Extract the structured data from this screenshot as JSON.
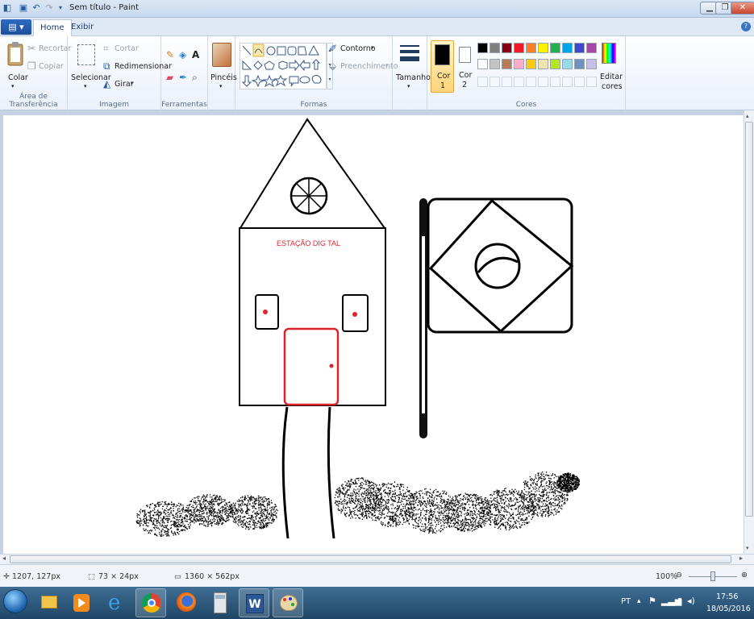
{
  "window": {
    "title": "Sem título - Paint",
    "qat_icons": [
      "paint-app-icon",
      "save-icon",
      "undo-icon",
      "redo-icon",
      "customize-icon"
    ],
    "controls": [
      "minimize-icon",
      "maximize-icon",
      "close-icon"
    ]
  },
  "tabs": {
    "file_menu": "file-menu-icon",
    "items": [
      "Home",
      "Exibir"
    ],
    "active": "Home"
  },
  "ribbon": {
    "clipboard": {
      "label": "Área de Transferência",
      "paste": "Colar",
      "cut": "Recortar",
      "copy": "Copiar"
    },
    "image": {
      "label": "Imagem",
      "select": "Selecionar",
      "crop": "Cortar",
      "resize": "Redimensionar",
      "rotate": "Girar"
    },
    "tools": {
      "label": "Ferramentas"
    },
    "brushes": {
      "label": "Pincéis"
    },
    "shapes": {
      "label": "Formas",
      "outline": "Contorno",
      "fill": "Preenchimento"
    },
    "size": {
      "label": "Tamanho"
    },
    "colors": {
      "label": "Cores",
      "color1": "Cor 1",
      "color1_l1": "Cor",
      "color1_l2": "1",
      "color2_l1": "Cor",
      "color2_l2": "2",
      "edit_l1": "Editar",
      "edit_l2": "cores",
      "color1_value": "#000000",
      "color2_value": "#ffffff",
      "palette_row1": [
        "#000000",
        "#7f7f7f",
        "#880015",
        "#ed1c24",
        "#ff7f27",
        "#fff200",
        "#22b14c",
        "#00a2e8",
        "#3f48cc",
        "#a349a4"
      ],
      "palette_row2": [
        "#ffffff",
        "#c3c3c3",
        "#b97a57",
        "#ffaec9",
        "#ffc90e",
        "#efe4b0",
        "#b5e61d",
        "#99d9ea",
        "#7092be",
        "#c8bfe7"
      ]
    }
  },
  "canvas": {
    "sign_text": "ESTAÇÃO DIG TAL"
  },
  "status": {
    "cursor_pos": "1207, 127px",
    "selection_size": "73 × 24px",
    "image_size": "1360 × 562px",
    "zoom": "100%"
  },
  "taskbar": {
    "apps": [
      "windows-start-icon",
      "file-explorer-icon",
      "media-player-icon",
      "internet-explorer-icon",
      "chrome-icon",
      "firefox-icon",
      "calculator-icon",
      "word-icon",
      "paint-icon"
    ],
    "language": "PT",
    "time": "17:56",
    "date": "18/05/2016"
  }
}
